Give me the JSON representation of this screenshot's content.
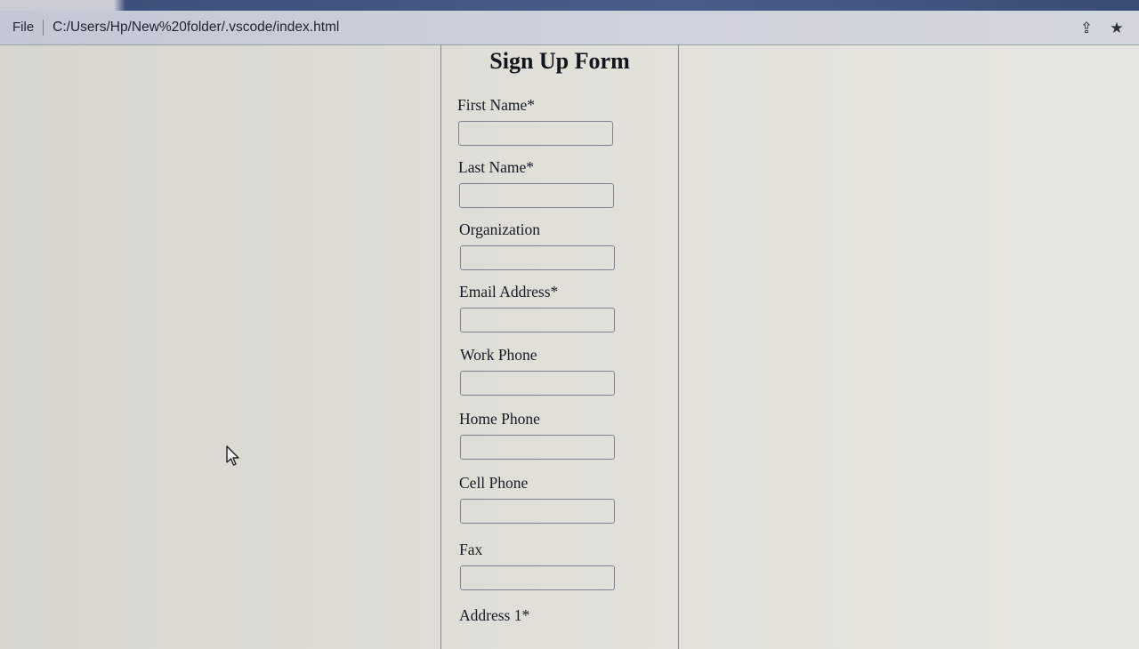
{
  "browser": {
    "file_label": "File",
    "url": "C:/Users/Hp/New%20folder/.vscode/index.html",
    "icons": [
      "share-icon",
      "star-icon"
    ]
  },
  "form": {
    "title": "Sign Up Form",
    "fields": [
      {
        "label": "First Name*",
        "value": ""
      },
      {
        "label": "Last Name*",
        "value": ""
      },
      {
        "label": "Organization",
        "value": ""
      },
      {
        "label": "Email Address*",
        "value": ""
      },
      {
        "label": "Work Phone",
        "value": ""
      },
      {
        "label": "Home Phone",
        "value": ""
      },
      {
        "label": "Cell Phone",
        "value": ""
      },
      {
        "label": "Fax",
        "value": ""
      },
      {
        "label": "Address 1*",
        "value": ""
      }
    ]
  }
}
